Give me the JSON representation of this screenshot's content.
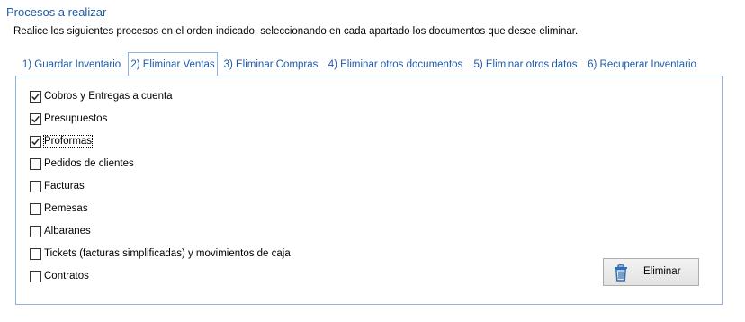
{
  "section_title": "Procesos a realizar",
  "instructions": "Realice los siguientes procesos en el orden indicado, seleccionando en cada apartado los documentos que desee eliminar.",
  "tabs": [
    {
      "label": "1) Guardar Inventario",
      "active": false
    },
    {
      "label": "2) Eliminar Ventas",
      "active": true
    },
    {
      "label": "3) Eliminar Compras",
      "active": false
    },
    {
      "label": "4) Eliminar otros documentos",
      "active": false
    },
    {
      "label": "5) Eliminar otros datos",
      "active": false
    },
    {
      "label": "6) Recuperar Inventario",
      "active": false
    }
  ],
  "items": [
    {
      "label": "Cobros y Entregas a cuenta",
      "checked": true
    },
    {
      "label": "Presupuestos",
      "checked": true
    },
    {
      "label": "Proformas",
      "checked": true,
      "focused": true
    },
    {
      "label": "Pedidos de clientes",
      "checked": false
    },
    {
      "label": "Facturas",
      "checked": false
    },
    {
      "label": "Remesas",
      "checked": false
    },
    {
      "label": "Albaranes",
      "checked": false
    },
    {
      "label": "Tickets (facturas simplificadas) y movimientos de caja",
      "checked": false
    },
    {
      "label": "Contratos",
      "checked": false
    }
  ],
  "delete_button": {
    "label": "Eliminar",
    "icon": "trash-icon"
  },
  "colors": {
    "accent": "#1e5aa8",
    "border": "#8fb2d9",
    "icon": "#2c6fb7"
  }
}
